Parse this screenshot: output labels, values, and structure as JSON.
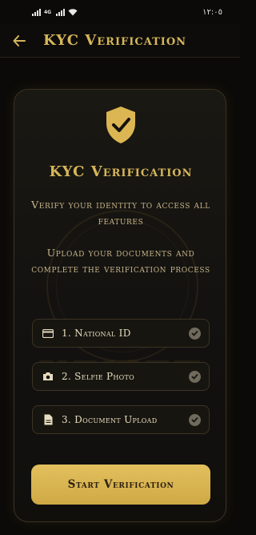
{
  "status_bar": {
    "time": "١٢:٠٥",
    "network": "4G"
  },
  "app_bar": {
    "title": "KYC Verification",
    "back_icon": "arrow-left-icon"
  },
  "card": {
    "icon": "shield-check-icon",
    "title": "KYC Verification",
    "description_1": "Verify your identity to access all features",
    "description_2": "Upload your documents and complete the verification process",
    "watermark_text": "KEMET",
    "steps": [
      {
        "label": "1. National ID",
        "icon": "id-card-icon",
        "status": "completed"
      },
      {
        "label": "2. Selfie Photo",
        "icon": "camera-icon",
        "status": "completed"
      },
      {
        "label": "3. Document Upload",
        "icon": "document-icon",
        "status": "completed"
      }
    ],
    "start_button": "Start Verification"
  },
  "colors": {
    "accent": "#d6b65a",
    "button_bg": "#dcb652",
    "background": "#0b0a08",
    "check_badge": "#6f6a5c"
  }
}
